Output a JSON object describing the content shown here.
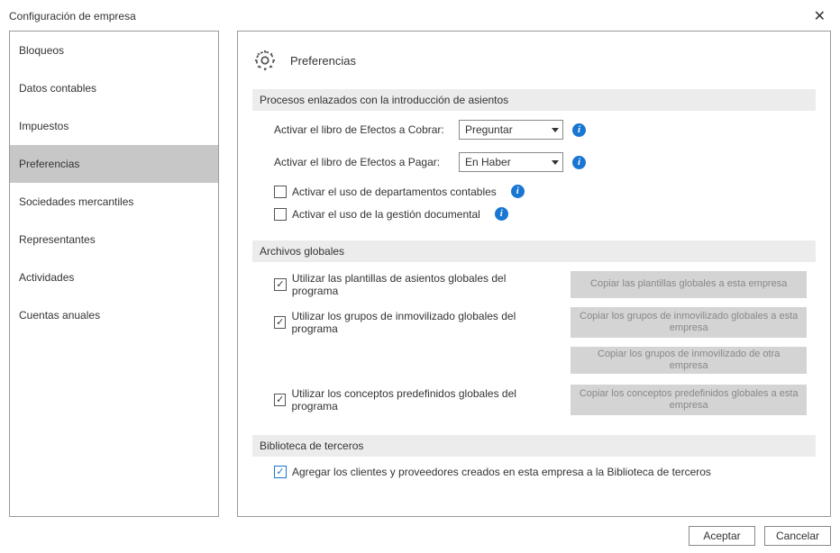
{
  "window": {
    "title": "Configuración de empresa"
  },
  "sidebar": {
    "items": [
      {
        "label": "Bloqueos"
      },
      {
        "label": "Datos contables"
      },
      {
        "label": "Impuestos"
      },
      {
        "label": "Preferencias"
      },
      {
        "label": "Sociedades mercantiles"
      },
      {
        "label": "Representantes"
      },
      {
        "label": "Actividades"
      },
      {
        "label": "Cuentas anuales"
      }
    ]
  },
  "header": {
    "title": "Preferencias"
  },
  "sections": {
    "procesos": {
      "title": "Procesos enlazados con la introducción de asientos",
      "cobrar_label": "Activar el libro de Efectos a Cobrar:",
      "cobrar_value": "Preguntar",
      "pagar_label": "Activar el libro de Efectos a Pagar:",
      "pagar_value": "En Haber",
      "dept_label": "Activar el uso de departamentos contables",
      "doc_label": "Activar el uso de la gestión documental"
    },
    "archivos": {
      "title": "Archivos globales",
      "plantillas_label": "Utilizar las plantillas de asientos globales del programa",
      "plantillas_btn": "Copiar las plantillas globales a esta empresa",
      "inmov_label": "Utilizar los grupos de inmovilizado globales del programa",
      "inmov_btn1": "Copiar los grupos de inmovilizado globales a esta empresa",
      "inmov_btn2": "Copiar los grupos de inmovilizado de otra empresa",
      "concept_label": "Utilizar los conceptos predefinidos globales del programa",
      "concept_btn": "Copiar los conceptos predefinidos globales a esta empresa"
    },
    "biblioteca": {
      "title": "Biblioteca de terceros",
      "label": "Agregar los clientes y proveedores creados en esta empresa a la Biblioteca de terceros"
    }
  },
  "footer": {
    "accept": "Aceptar",
    "cancel": "Cancelar"
  }
}
